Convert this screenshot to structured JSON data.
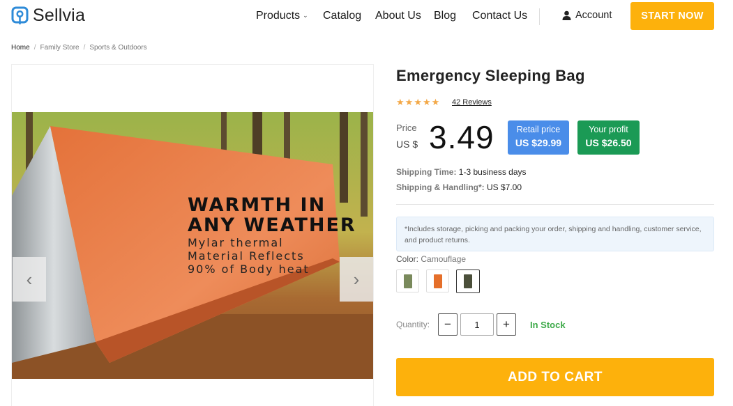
{
  "brand": {
    "name": "Sellvia",
    "accent": "#fdb10c"
  },
  "nav": {
    "items": [
      {
        "label": "Products",
        "has_dropdown": true
      },
      {
        "label": "Catalog"
      },
      {
        "label": "About Us"
      },
      {
        "label": "Blog"
      },
      {
        "label": "Contact Us"
      }
    ],
    "account_label": "Account",
    "cta_label": "START NOW"
  },
  "breadcrumb": [
    "Home",
    "Family Store",
    "Sports & Outdoors"
  ],
  "product": {
    "title": "Emergency Sleeping Bag",
    "rating": 5,
    "reviews_label": "42 Reviews",
    "price_label": "Price",
    "currency_label": "US $",
    "price": "3.49",
    "retail": {
      "label": "Retail price",
      "value": "US $29.99",
      "color": "#4a8de9"
    },
    "profit": {
      "label": "Your profit",
      "value": "US $26.50",
      "color": "#1b9a55"
    },
    "shipping_time": {
      "key": "Shipping Time:",
      "value": "1-3 business days"
    },
    "shipping_handling": {
      "key": "Shipping & Handling*:",
      "value": "US $7.00"
    },
    "note": "*Includes storage, picking and packing your order, shipping and handling, customer service, and product returns.",
    "color_key": "Color:",
    "color_value": "Camouflage",
    "swatches": [
      {
        "name": "green",
        "color": "#7a8a5c"
      },
      {
        "name": "orange",
        "color": "#e56f2a"
      },
      {
        "name": "camouflage",
        "color": "#4b4f3a",
        "selected": true
      }
    ],
    "quantity_label": "Quantity:",
    "quantity": "1",
    "stock_label": "In Stock",
    "add_to_cart": "ADD TO CART"
  },
  "image": {
    "caption_line1": "WARMTH IN",
    "caption_line2": "ANY WEATHER",
    "caption_line3": "Mylar thermal",
    "caption_line4": "Material Reflects",
    "caption_line5": "90% of Body heat"
  },
  "icons": {
    "prev": "chevron-left-icon",
    "next": "chevron-right-icon",
    "account": "user-icon",
    "logo": "map-pin-icon"
  }
}
